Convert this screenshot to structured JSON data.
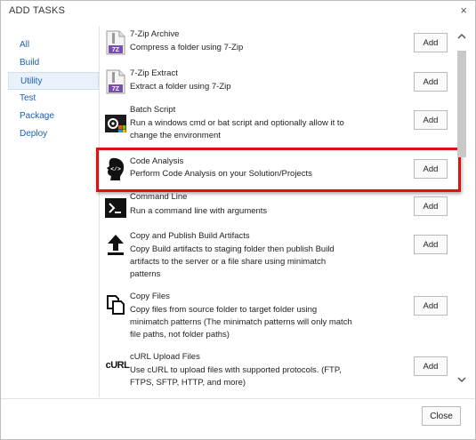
{
  "dialog": {
    "title": "ADD TASKS",
    "close_glyph": "×"
  },
  "sidebar": {
    "items": [
      {
        "label": "All"
      },
      {
        "label": "Build"
      },
      {
        "label": "Utility",
        "active": true
      },
      {
        "label": "Test"
      },
      {
        "label": "Package"
      },
      {
        "label": "Deploy"
      }
    ]
  },
  "tasks": [
    {
      "name": "7-Zip Archive",
      "description": "Compress a folder using 7-Zip",
      "icon": "7zip-archive-icon",
      "add_label": "Add"
    },
    {
      "name": "7-Zip Extract",
      "description": "Extract a folder using 7-Zip",
      "icon": "7zip-extract-icon",
      "add_label": "Add"
    },
    {
      "name": "Batch Script",
      "description": "Run a windows cmd or bat script and optionally allow it to change the environment",
      "icon": "batch-script-icon",
      "add_label": "Add"
    },
    {
      "name": "Code Analysis",
      "description": "Perform Code Analysis on your Solution/Projects",
      "icon": "code-analysis-icon",
      "add_label": "Add",
      "highlighted": true
    },
    {
      "name": "Command Line",
      "description": "Run a command line with arguments",
      "icon": "command-line-icon",
      "add_label": "Add"
    },
    {
      "name": "Copy and Publish Build Artifacts",
      "description": "Copy Build artifacts to staging folder then publish Build artifacts to the server or a file share using minimatch patterns",
      "icon": "upload-arrow-icon",
      "add_label": "Add"
    },
    {
      "name": "Copy Files",
      "description": "Copy files from source folder to target folder using minimatch patterns (The minimatch patterns will only match file paths, not folder paths)",
      "icon": "copy-files-icon",
      "add_label": "Add"
    },
    {
      "name": "cURL Upload Files",
      "description": "Use cURL to upload files with supported protocols. (FTP, FTPS, SFTP, HTTP, and more)",
      "icon": "curl-icon",
      "icon_text": "cURL",
      "add_label": "Add"
    }
  ],
  "zip_badge": "7Z",
  "footer": {
    "close_label": "Close"
  },
  "colors": {
    "accent": "#1a5fb4",
    "highlight": "#e01010"
  }
}
